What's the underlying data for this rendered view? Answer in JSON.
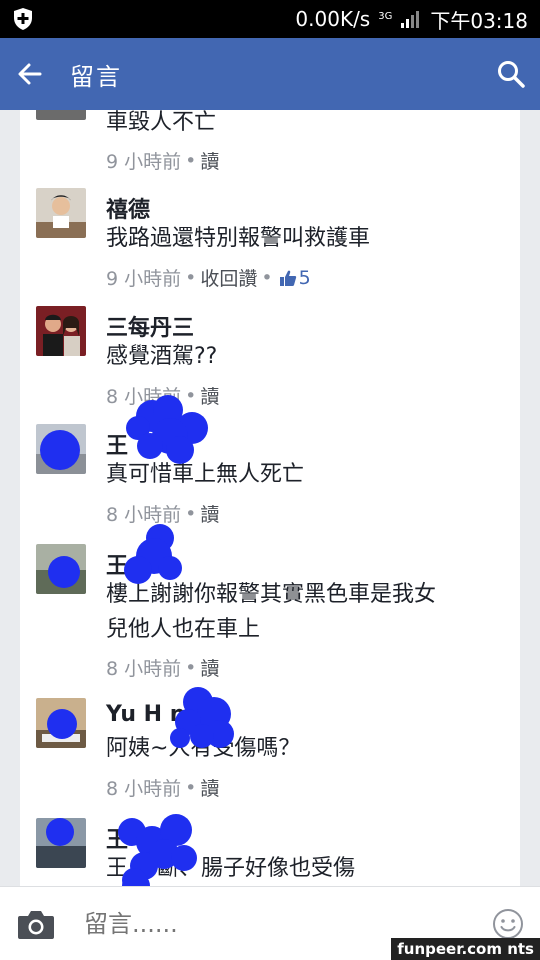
{
  "status_bar": {
    "speed": "0.00K/s",
    "network": "3G",
    "time": "下午03:18",
    "icons": [
      "shield-icon",
      "signal-icon"
    ]
  },
  "app_bar": {
    "title": "留言",
    "icons": [
      "back-arrow-icon",
      "search-icon"
    ],
    "color": "#4267b2"
  },
  "comments": [
    {
      "name": "",
      "text": "車毀人不亡",
      "time": "9 小時前",
      "action": "讀"
    },
    {
      "name": "禧德",
      "text": "我路過還特別報警叫救護車",
      "time": "9 小時前",
      "action": "收回讚",
      "likes": "5"
    },
    {
      "name": "三每丹三",
      "text": "感覺酒駕??",
      "time": "8 小時前",
      "action": "讀"
    },
    {
      "name": "王",
      "text": "真可惜車上無人死亡",
      "time": "8 小時前",
      "action": "讀"
    },
    {
      "name": "王",
      "text_lines": [
        "樓上謝謝你報警其實黑色車是我女",
        "兒他人也在車上"
      ],
      "time": "8 小時前",
      "action": "讀"
    },
    {
      "name": "Yu H    n Li",
      "text": "阿姨~人有受傷嗎？",
      "time": "8 小時前",
      "action": "讀"
    },
    {
      "name": "王",
      "text": "王    腳斷、腸子好像也受傷"
    }
  ],
  "composer": {
    "placeholder": "留言......",
    "icons": [
      "camera-icon",
      "smile-icon"
    ]
  },
  "watermark": "funpeer.com nts",
  "colors": {
    "brand": "#4267b2",
    "scribble": "#1f2ff0",
    "meta_text": "#90949c"
  }
}
